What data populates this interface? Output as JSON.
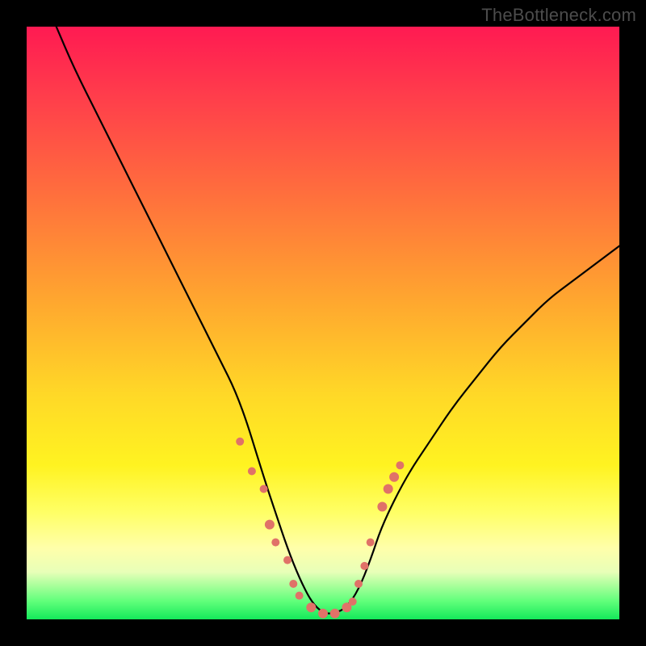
{
  "watermark": "TheBottleneck.com",
  "chart_data": {
    "type": "line",
    "title": "",
    "xlabel": "",
    "ylabel": "",
    "xlim": [
      0,
      100
    ],
    "ylim": [
      0,
      100
    ],
    "grid": false,
    "series": [
      {
        "name": "bottleneck-curve",
        "x": [
          5,
          8,
          12,
          16,
          20,
          24,
          28,
          32,
          36,
          40,
          42,
          44,
          46,
          48,
          50,
          52,
          54,
          56,
          58,
          60,
          64,
          68,
          72,
          76,
          80,
          84,
          88,
          92,
          96,
          100
        ],
        "y": [
          100,
          93,
          85,
          77,
          69,
          61,
          53,
          45,
          37,
          24,
          18,
          12,
          7,
          3,
          1,
          1,
          2,
          5,
          10,
          16,
          24,
          30,
          36,
          41,
          46,
          50,
          54,
          57,
          60,
          63
        ]
      }
    ],
    "markers": [
      {
        "x": 36,
        "y": 30,
        "r": 5
      },
      {
        "x": 38,
        "y": 25,
        "r": 5
      },
      {
        "x": 40,
        "y": 22,
        "r": 5
      },
      {
        "x": 41,
        "y": 16,
        "r": 6
      },
      {
        "x": 42,
        "y": 13,
        "r": 5
      },
      {
        "x": 44,
        "y": 10,
        "r": 5
      },
      {
        "x": 45,
        "y": 6,
        "r": 5
      },
      {
        "x": 46,
        "y": 4,
        "r": 5
      },
      {
        "x": 48,
        "y": 2,
        "r": 6
      },
      {
        "x": 50,
        "y": 1,
        "r": 6
      },
      {
        "x": 52,
        "y": 1,
        "r": 6
      },
      {
        "x": 54,
        "y": 2,
        "r": 6
      },
      {
        "x": 55,
        "y": 3,
        "r": 5
      },
      {
        "x": 56,
        "y": 6,
        "r": 5
      },
      {
        "x": 57,
        "y": 9,
        "r": 5
      },
      {
        "x": 58,
        "y": 13,
        "r": 5
      },
      {
        "x": 60,
        "y": 19,
        "r": 6
      },
      {
        "x": 61,
        "y": 22,
        "r": 6
      },
      {
        "x": 62,
        "y": 24,
        "r": 6
      },
      {
        "x": 63,
        "y": 26,
        "r": 5
      }
    ]
  }
}
